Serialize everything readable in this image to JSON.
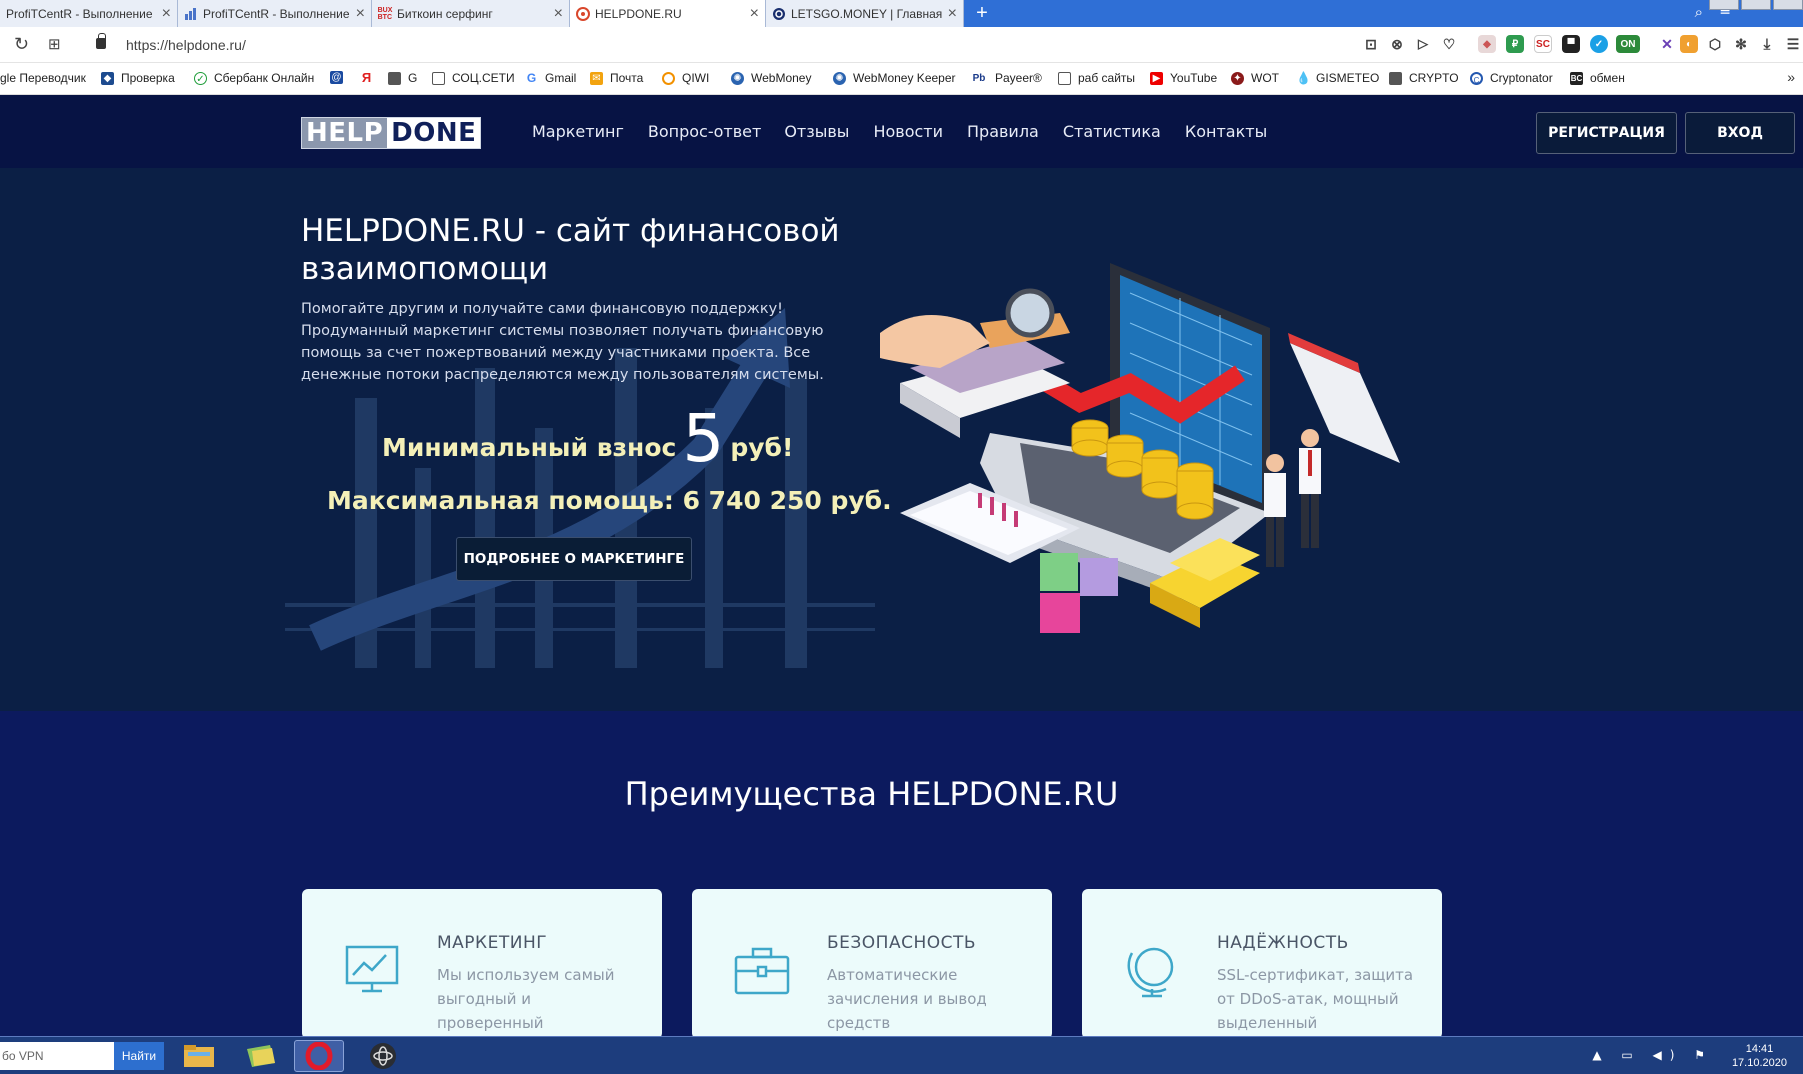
{
  "browser": {
    "tabs": [
      {
        "title": "ProfiTCentR - Выполнение",
        "favicon": "chart-favicon"
      },
      {
        "title": "ProfiTCentR - Выполнение",
        "favicon": "chart-favicon"
      },
      {
        "title": "Биткоин серфинг",
        "favicon": "bux-btc-favicon"
      },
      {
        "title": "HELPDONE.RU",
        "favicon": "helpdone-favicon",
        "active": true
      },
      {
        "title": "LETSGO.MONEY | Главная",
        "favicon": "letsgo-favicon"
      }
    ],
    "new_tab": "+",
    "url": "https://helpdone.ru/",
    "bookmarks": [
      "gle Переводчик",
      "Проверка",
      "Сбербанк Онлайн",
      "",
      "",
      "G",
      "СОЦ.СЕТИ",
      "Gmail",
      "Почта",
      "QIWI",
      "WebMoney",
      "WebMoney Keeper",
      "Payeer®",
      "раб сайты",
      "YouTube",
      "WOT",
      "GISMETEO",
      "CRYPTO",
      "Cryptonator",
      "обмен"
    ]
  },
  "site": {
    "logo": {
      "part1": "HELP",
      "part2": "DONE"
    },
    "nav": [
      "Маркетинг",
      "Вопрос-ответ",
      "Отзывы",
      "Новости",
      "Правила",
      "Статистика",
      "Контакты"
    ],
    "register_label": "РЕГИСТРАЦИЯ",
    "login_label": "ВХОД"
  },
  "hero": {
    "title": "HELPDONE.RU - сайт финансовой взаимопомощи",
    "text": "Помогайте другим и получайте сами финансовую поддержку! Продуманный маркетинг системы позволяет получать финансовую помощь за счет пожертвований между участниками проекта. Все денежные потоки распределяются между пользователям системы.",
    "min_prefix": "Минимальный взнос",
    "min_value": "5",
    "min_suffix": "руб!",
    "max_line": "Максимальная помощь: 6 740 250 руб.",
    "button": "ПОДРОБНЕЕ О МАРКЕТИНГЕ"
  },
  "advantages": {
    "title": "Преимущества HELPDONE.RU",
    "cards": [
      {
        "title": "МАРКЕТИНГ",
        "text": "Мы используем самый выгодный и проверенный",
        "icon": "chart-board-icon"
      },
      {
        "title": "БЕЗОПАСНОСТЬ",
        "text": "Автоматические зачисления и вывод средств",
        "icon": "briefcase-icon"
      },
      {
        "title": "НАДЁЖНОСТЬ",
        "text": "SSL-сертификат, защита от DDoS-атак, мощный выделенный",
        "icon": "globe-icon"
      }
    ],
    "accent_color": "#3ea7c9"
  },
  "taskbar": {
    "search_text": "бо VPN",
    "search_button": "Найти",
    "time": "14:41",
    "date": "17.10.2020"
  },
  "colors": {
    "header_bg": "#071344",
    "hero_bg": "#0b1f45",
    "body_bg": "#0c1a5e",
    "highlight_text": "#f4f0b8"
  }
}
